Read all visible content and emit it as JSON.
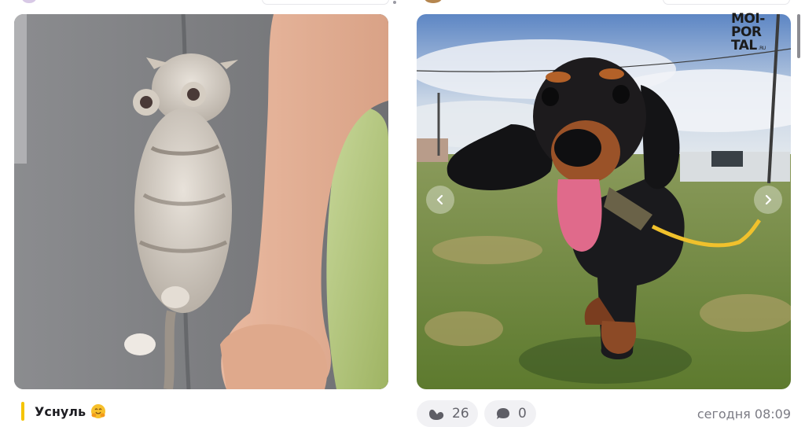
{
  "posts": [
    {
      "image": "sleeping-kitten-photo",
      "caption": "Уснуль",
      "caption_emoji": "hugging-face"
    },
    {
      "image": "dachshund-puppy-photo",
      "watermark": {
        "lines": [
          "MOI-",
          "POR",
          "TAL"
        ],
        "suffix": ".RU"
      },
      "stats": {
        "likes": "26",
        "comments": "0"
      },
      "timestamp": "сегодня 08:09"
    }
  ],
  "colors": {
    "caption_accent": "#f5c400",
    "pill_bg": "#f1f1f4",
    "muted_text": "#7b7b84"
  }
}
